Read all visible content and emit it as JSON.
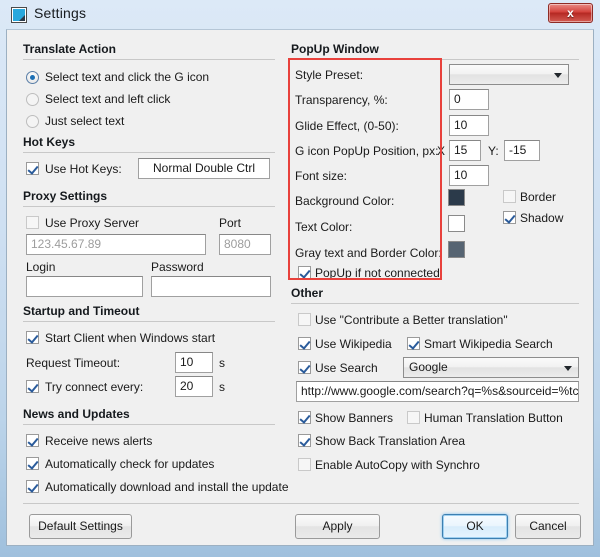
{
  "window": {
    "title": "Settings",
    "close_label": "x",
    "icon": "app-icon"
  },
  "translate_action": {
    "group_title": "Translate Action",
    "options": [
      {
        "label": "Select text and click the G icon",
        "checked": true
      },
      {
        "label": "Select text and left click",
        "checked": false
      },
      {
        "label": "Just select text",
        "checked": false
      }
    ]
  },
  "hot_keys": {
    "group_title": "Hot Keys",
    "use_hot_keys": {
      "label": "Use Hot Keys:",
      "checked": true
    },
    "hotkey_value": "Normal Double Ctrl"
  },
  "proxy_settings": {
    "group_title": "Proxy Settings",
    "use_proxy": {
      "label": "Use Proxy Server",
      "checked": false
    },
    "port_label": "Port",
    "server_placeholder": "123.45.67.89",
    "server_value": "",
    "port_value": "8080",
    "login_label": "Login",
    "login_value": "",
    "password_label": "Password",
    "password_value": ""
  },
  "startup_timeout": {
    "group_title": "Startup and Timeout",
    "start_client": {
      "label": "Start Client when Windows start",
      "checked": true
    },
    "request_timeout_label": "Request Timeout:",
    "request_timeout_value": "10",
    "request_timeout_unit": "s",
    "try_connect": {
      "label": "Try connect every:",
      "checked": true
    },
    "try_connect_value": "20",
    "try_connect_unit": "s"
  },
  "news_updates": {
    "group_title": "News and Updates",
    "items": [
      {
        "label": "Receive news alerts",
        "checked": true
      },
      {
        "label": "Automatically check for updates",
        "checked": true
      },
      {
        "label": "Automatically download and install the update",
        "checked": true
      }
    ]
  },
  "popup_window": {
    "group_title": "PopUp Window",
    "style_preset_label": "Style Preset:",
    "style_preset_value": "",
    "transparency_label": "Transparency, %:",
    "transparency_value": "0",
    "glide_label": "Glide Effect, (0-50):",
    "glide_value": "10",
    "position_label": "G icon PopUp Position, px:",
    "position_x_label": "X",
    "position_x_value": "15",
    "position_y_label": "Y:",
    "position_y_value": "-15",
    "font_size_label": "Font size:",
    "font_size_value": "10",
    "background_color_label": "Background Color:",
    "background_color_value": "#2b3a4a",
    "text_color_label": "Text Color:",
    "text_color_value": "#ffffff",
    "gray_border_color_label": "Gray text and Border Color:",
    "gray_border_color_value": "#566472",
    "border": {
      "label": "Border",
      "checked": false
    },
    "shadow": {
      "label": "Shadow",
      "checked": true
    },
    "popup_if_not_connected": {
      "label": "PopUp if not connected",
      "checked": true
    },
    "highlight_color": "#e8413c"
  },
  "other": {
    "group_title": "Other",
    "contribute": {
      "label": "Use \"Contribute a Better translation\"",
      "checked": false
    },
    "use_wikipedia": {
      "label": "Use Wikipedia",
      "checked": true
    },
    "smart_wikipedia": {
      "label": "Smart Wikipedia Search",
      "checked": true
    },
    "use_search": {
      "label": "Use Search",
      "checked": true
    },
    "search_engine_value": "Google",
    "search_url_value": "http://www.google.com/search?q=%s&sourceid=%tc&ie",
    "show_banners": {
      "label": "Show Banners",
      "checked": true
    },
    "human_translation": {
      "label": "Human Translation Button",
      "checked": false
    },
    "show_back_translation": {
      "label": "Show Back Translation Area",
      "checked": true
    },
    "enable_autocopy": {
      "label": "Enable AutoCopy with Synchro",
      "checked": false
    }
  },
  "footer": {
    "default_settings": "Default Settings",
    "apply": "Apply",
    "ok": "OK",
    "cancel": "Cancel"
  }
}
